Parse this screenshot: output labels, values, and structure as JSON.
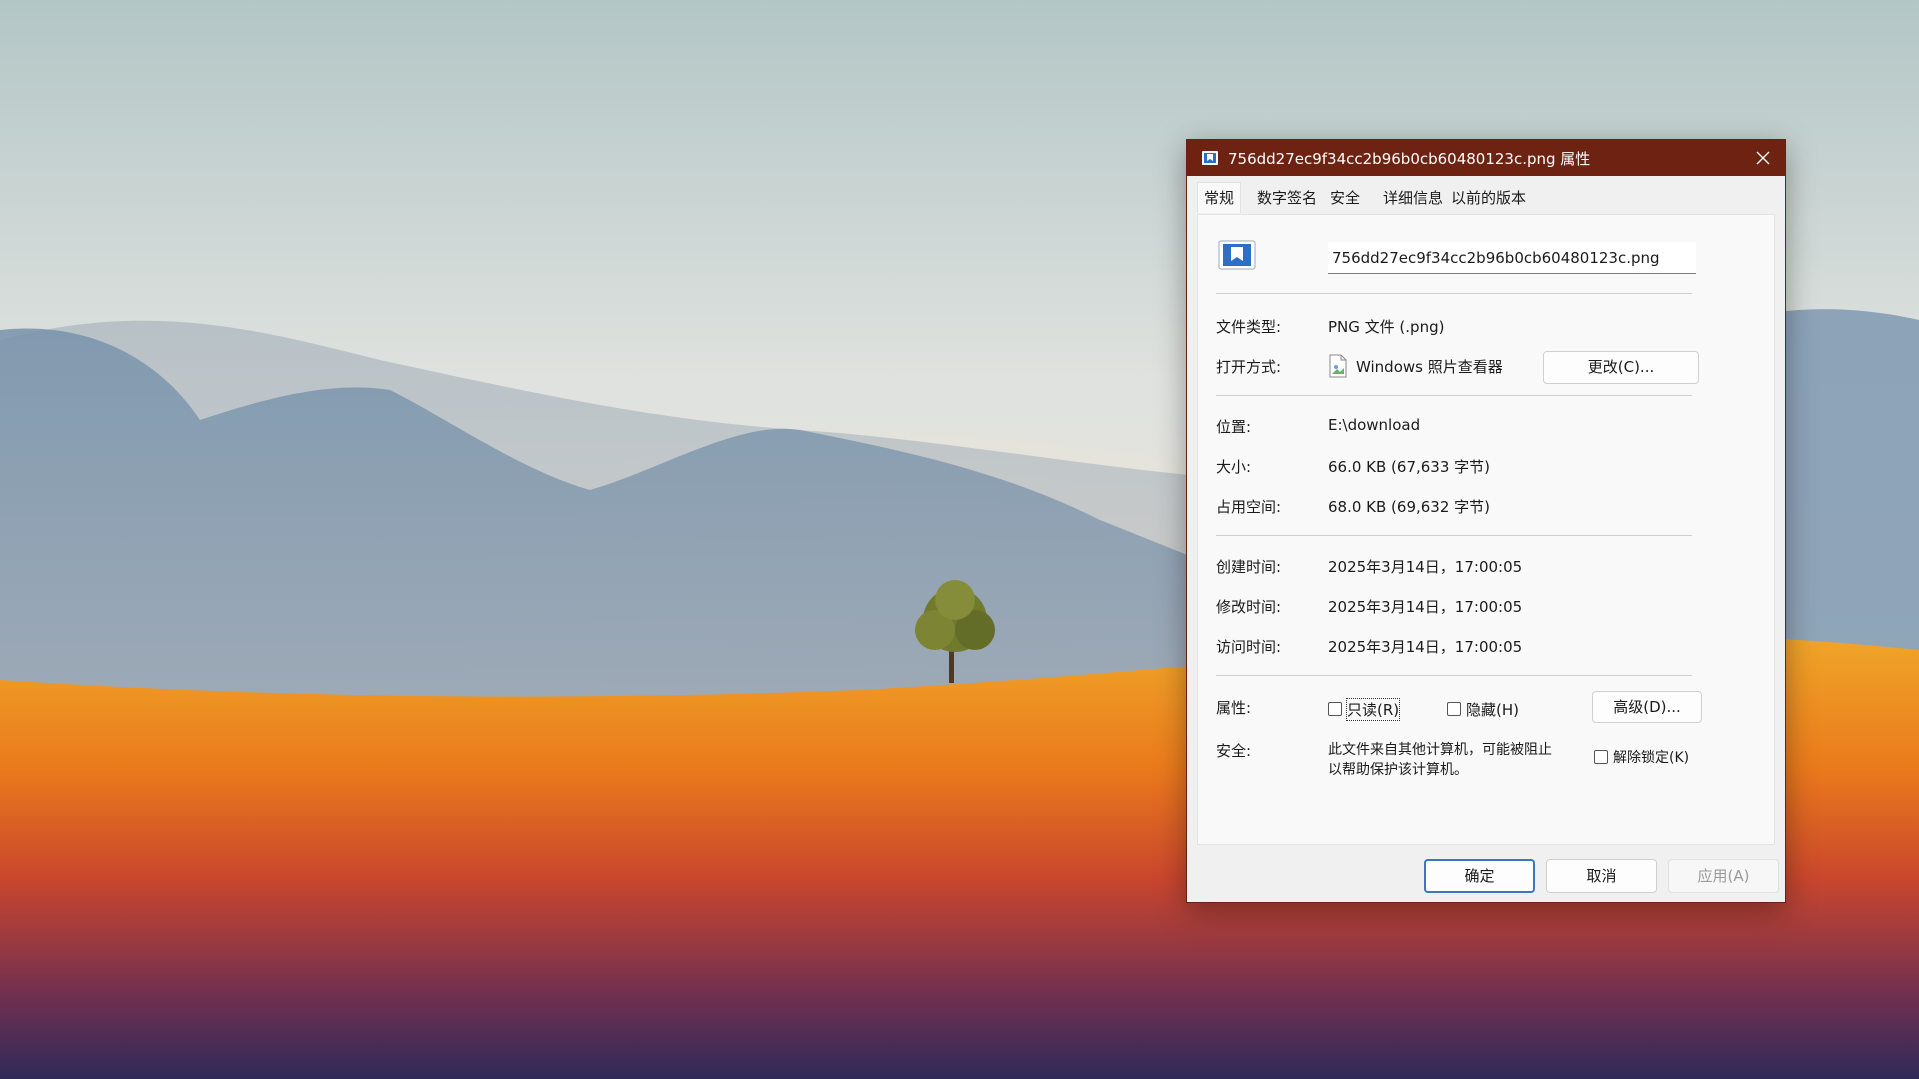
{
  "dialog": {
    "title": "756dd27ec9f34cc2b96b0cb60480123c.png 属性",
    "tabs": [
      "常规",
      "数字签名",
      "安全",
      "详细信息",
      "以前的版本"
    ],
    "active_tab": "常规",
    "filename": "756dd27ec9f34cc2b96b0cb60480123c.png",
    "file_type_label": "文件类型:",
    "file_type_value": "PNG 文件 (.png)",
    "open_with_label": "打开方式:",
    "open_with_value": "Windows 照片查看器",
    "change_button": "更改(C)...",
    "location_label": "位置:",
    "location_value": "E:\\download",
    "size_label": "大小:",
    "size_value": "66.0 KB (67,633 字节)",
    "size_on_disk_label": "占用空间:",
    "size_on_disk_value": "68.0 KB (69,632 字节)",
    "created_label": "创建时间:",
    "created_value": "2025年3月14日，17:00:05",
    "modified_label": "修改时间:",
    "modified_value": "2025年3月14日，17:00:05",
    "accessed_label": "访问时间:",
    "accessed_value": "2025年3月14日，17:00:05",
    "attributes_label": "属性:",
    "readonly_label": "只读(R)",
    "readonly_checked": false,
    "hidden_label": "隐藏(H)",
    "hidden_checked": false,
    "advanced_button": "高级(D)...",
    "security_label": "安全:",
    "security_text_line1": "此文件来自其他计算机，可能被阻止",
    "security_text_line2": "以帮助保护该计算机。",
    "unblock_label": "解除锁定(K)",
    "unblock_checked": false,
    "ok_button": "确定",
    "cancel_button": "取消",
    "apply_button": "应用(A)"
  },
  "icons": {
    "title_icon": "image-file-icon",
    "close_icon": "close-icon",
    "file_icon": "image-file-icon",
    "app_icon": "photo-viewer-icon"
  },
  "colors": {
    "titlebar": "#6e2212",
    "primary_button_border": "#3c75c8"
  }
}
